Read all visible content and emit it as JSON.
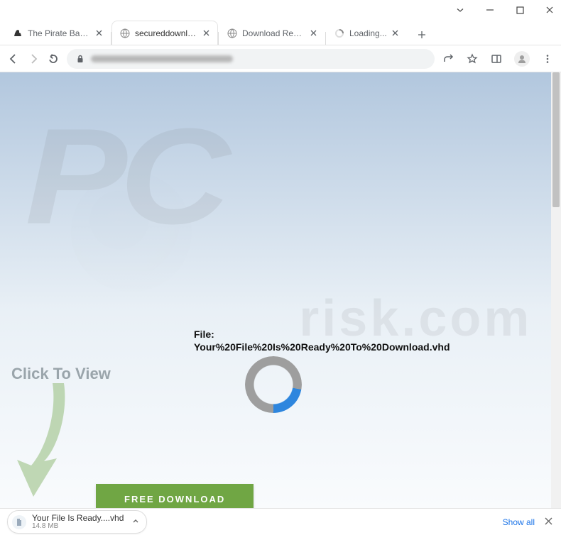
{
  "window_controls": {
    "min": "minimize",
    "max": "maximize",
    "close": "close"
  },
  "tabs": [
    {
      "title": "The Pirate Bay - The g",
      "favicon": "piratebay"
    },
    {
      "title": "secureddownload",
      "favicon": "globe"
    },
    {
      "title": "Download Ready",
      "favicon": "globe"
    },
    {
      "title": "Loading...",
      "favicon": "spinner"
    }
  ],
  "active_tab_index": 1,
  "page": {
    "file_label": "File:",
    "file_name": "Your%20File%20Is%20Ready%20To%20Download.vhd",
    "click_to_view": "Click To View",
    "download_button": "FREE DOWNLOAD"
  },
  "download_bar": {
    "file_name": "Your File Is Ready....vhd",
    "file_size": "14.8 MB",
    "show_all": "Show all"
  },
  "watermark": {
    "pc": "PC",
    "risk": "risk.com"
  }
}
